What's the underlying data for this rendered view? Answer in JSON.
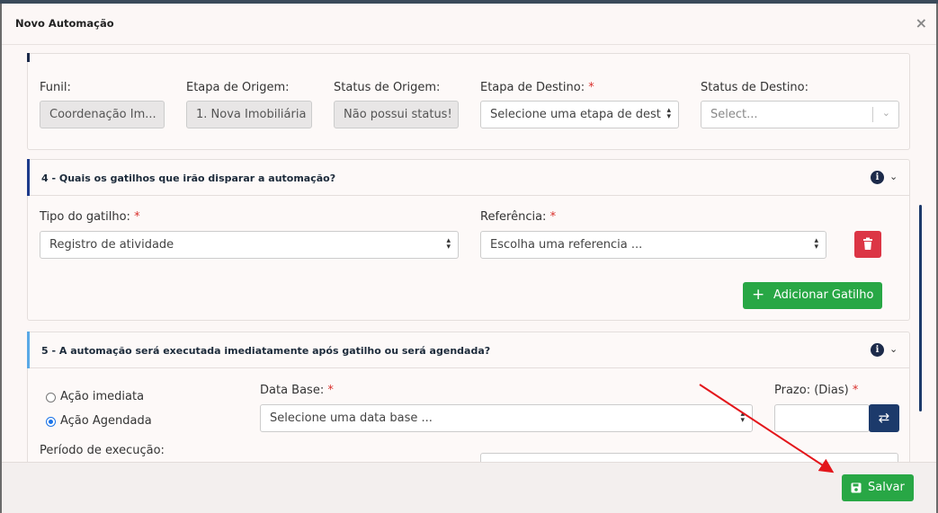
{
  "modal": {
    "title": "Novo Automação",
    "close_label": "×"
  },
  "top_section": {
    "funil": {
      "label": "Funil:",
      "value": "Coordenação Im..."
    },
    "etapa_origem": {
      "label": "Etapa de Origem:",
      "value": "1. Nova Imobiliária"
    },
    "status_origem": {
      "label": "Status de Origem:",
      "value": "Não possui status!"
    },
    "etapa_destino": {
      "label": "Etapa de Destino:",
      "required": "*",
      "value": "Selecione uma etapa de dest"
    },
    "status_destino": {
      "label": "Status de Destino:",
      "placeholder": "Select..."
    }
  },
  "section4": {
    "title": "4 - Quais os gatilhos que irão disparar a automação?",
    "tipo_gatilho": {
      "label": "Tipo do gatilho:",
      "required": "*",
      "value": "Registro de atividade"
    },
    "referencia": {
      "label": "Referência:",
      "required": "*",
      "value": "Escolha uma referencia ..."
    },
    "add_button": "Adicionar Gatilho"
  },
  "section5": {
    "title": "5 - A automação será executada imediatamente após gatilho ou será agendada?",
    "radio_imediata": "Ação imediata",
    "radio_agendada": "Ação Agendada",
    "data_base": {
      "label": "Data Base:",
      "required": "*",
      "value": "Selecione uma data base ..."
    },
    "prazo": {
      "label": "Prazo: (Dias)",
      "required": "*",
      "value": ""
    },
    "periodo_label": "Período de execução:"
  },
  "footer": {
    "save_label": "Salvar"
  },
  "colors": {
    "accent_green": "#28a745",
    "danger_red": "#dc3545",
    "navy": "#1c3a6b",
    "annotation_arrow": "#e3161b"
  }
}
